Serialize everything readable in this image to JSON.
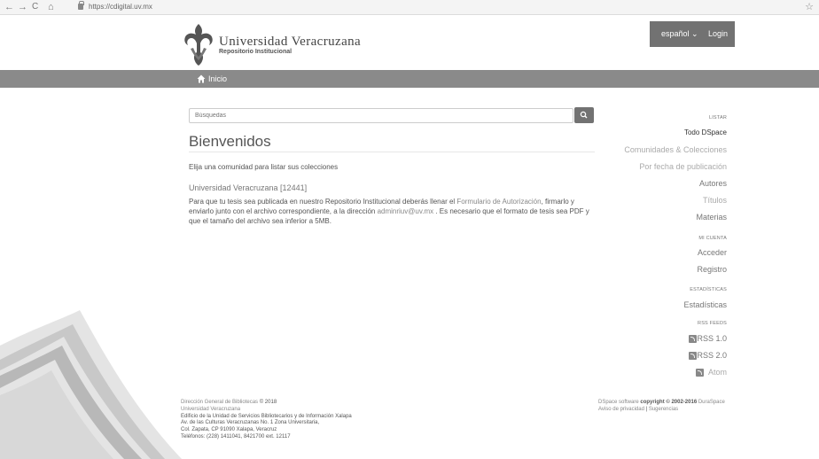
{
  "browser": {
    "back": "←",
    "forward": "→",
    "reload": "C",
    "home": "⌂",
    "url": "https://cdigital.uv.mx",
    "star": "☆"
  },
  "header": {
    "site_name": "Universidad Veracruzana",
    "site_sub": "Repositorio Institucional",
    "language": "español ⌄",
    "login": "Login"
  },
  "nav": {
    "home": "Inicio"
  },
  "search": {
    "placeholder": "Búsquedas"
  },
  "main": {
    "title": "Bienvenidos",
    "intro": "Elija una comunidad para listar sus colecciones",
    "community": "Universidad Veracruzana [12441]",
    "para": {
      "p1": "Para que tu tesis sea publicada en nuestro Repositorio Institucional deberás llenar el ",
      "link1": "Formulario de Autorización",
      "p2": ", firmarlo y enviarlo junto con el archivo correspondiente, a la dirección ",
      "link2": "adminriuv@uv.mx",
      "p3": " . Es necesario que el formato de tesis sea PDF y que el tamaño del archivo sea inferior a 5MB."
    }
  },
  "sidebar": {
    "listar": {
      "heading": "LISTAR",
      "items": [
        "Todo DSpace",
        "Comunidades & Colecciones",
        "Por fecha de publicación",
        "Autores",
        "Títulos",
        "Materias"
      ]
    },
    "cuenta": {
      "heading": "MI CUENTA",
      "items": [
        "Acceder",
        "Registro"
      ]
    },
    "estadisticas": {
      "heading": "ESTADÍSTICAS",
      "items": [
        "Estadísticas"
      ]
    },
    "rss": {
      "heading": "RSS FEEDS",
      "items": [
        "RSS 1.0",
        "RSS 2.0",
        "Atom"
      ]
    }
  },
  "footer": {
    "left": {
      "l1_link": "Dirección General de Bibliotecas",
      "l1_rest": " © 2018",
      "l2": "Universidad Veracruzana",
      "l3": "Edificio de la Unidad de Servicios Bibliotecarios y de Información Xalapa",
      "l4": "Av. de las Culturas Veracruzanas No. 1 Zona Universitaria,",
      "l5": "Col. Zapata, CP 91090 Xalapa, Veracruz",
      "l6": "Teléfonos: (228) 1411041, 8421700 ext. 12117"
    },
    "right": {
      "r1_link": "DSpace software",
      "r1_rest": " copyright © 2002-2016 ",
      "r1_link2": "DuraSpace",
      "r2_link": "Aviso de privacidad",
      "r2_sep": " | ",
      "r2_link2": "Sugerencias"
    }
  }
}
